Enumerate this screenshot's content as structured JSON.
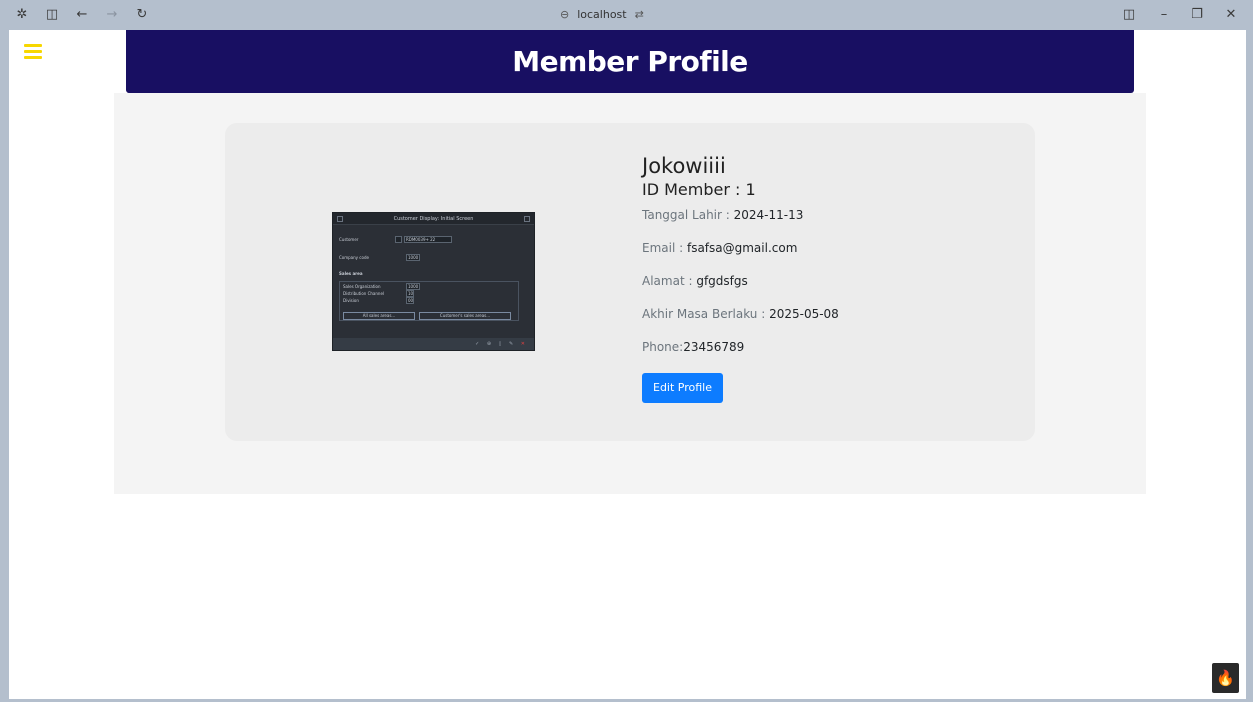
{
  "browser": {
    "address": "localhost",
    "icons": {
      "app": "butterfly-icon",
      "sidebar": "sidebar-toggle-icon",
      "back": "back-arrow-icon",
      "forward": "forward-arrow-icon",
      "reload": "reload-icon",
      "link": "link-icon",
      "tune": "tune-icon",
      "split": "split-view-icon",
      "minimize": "minimize-icon",
      "restore": "restore-icon",
      "close": "close-icon"
    }
  },
  "header": {
    "title": "Member Profile"
  },
  "profile": {
    "name": "Jokowiiii",
    "id_label": "ID Member : 1",
    "fields": [
      {
        "label": "Tanggal Lahir : ",
        "value": "2024-11-13"
      },
      {
        "label": "Email : ",
        "value": "fsafsa@gmail.com"
      },
      {
        "label": "Alamat : ",
        "value": "gfgdsfgs"
      },
      {
        "label": "Akhir Masa Berlaku : ",
        "value": "2025-05-08"
      },
      {
        "label": "Phone:",
        "value": "23456789"
      }
    ],
    "edit_label": "Edit Profile"
  },
  "photo": {
    "title": "Customer Display: Initial Screen",
    "customer_label": "Customer",
    "customer_value": "RDM0039+ 22",
    "company_label": "Company code",
    "company_value": "1000",
    "sales_area_label": "Sales area",
    "sales_org_label": "Sales Organization",
    "sales_org_value": "1000",
    "dist_label": "Distribution Channel",
    "dist_value": "10",
    "division_label": "Division",
    "division_value": "00",
    "btn_all": "All sales areas...",
    "btn_customer": "Customer's sales areas..."
  },
  "colors": {
    "header_bg": "#180f62",
    "menu_icon": "#f7d700",
    "button": "#0d7cff"
  }
}
